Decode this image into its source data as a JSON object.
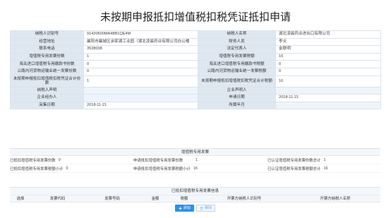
{
  "title": "未按期申报抵扣增值税扣税凭证抵扣申请",
  "info_rows": [
    {
      "l1": "纳税人识别号",
      "v1": "91420600MA48B1QE4M",
      "l2": "纳税人名称",
      "v2": "湖北凌晨药业进出口有限公司"
    },
    {
      "l1": "经营地址",
      "v1": "襄阳市襄城区余家湖工业园（湖北凌晨药业有限公司办公楼",
      "l2": "财务人员",
      "v2": "李炎"
    },
    {
      "l1": "联系电话",
      "v1": "3538038",
      "l2": "法定代表人",
      "v2": "金联明"
    },
    {
      "l1": "增值税专用发票份数",
      "v1": "1",
      "l2": "增值税专用发票税额",
      "v2": "16"
    },
    {
      "l1": "海关进口增值税专用缴款书份数",
      "v1": "0",
      "l2": "海关进口增值税专用缴款书税额",
      "v2": "0"
    },
    {
      "l1": "公路内河货物运输业统一发票份数",
      "v1": "0",
      "l2": "公路内河货物运输业统一发票税额",
      "v2": "0"
    },
    {
      "l1": "未按期申报抵扣增值税扣税凭证合计份数",
      "v1": "1",
      "l2": "未按期申报抵扣增值税扣税凭证合计税额",
      "v2": "16"
    },
    {
      "l1": "纳税人声明",
      "v1": "",
      "l2": "企业声明人",
      "v2": ""
    },
    {
      "l1": "企业经办人",
      "v1": "",
      "l2": "申请日期",
      "v2": "2018-11-21"
    },
    {
      "l1": "采集日期",
      "v1": "2018-11-21",
      "l2": "所属年月",
      "v2": ""
    }
  ],
  "stats": {
    "header": "增值税专用发票",
    "row1": [
      {
        "label": "已抵扣增值税专用发票份数",
        "value": "0"
      },
      {
        "label": "申请抵扣增值税专用发票份数",
        "value": "1"
      },
      {
        "label": "已认证增值税专用发票份数总计",
        "value": "1"
      }
    ],
    "row2": [
      {
        "label": "已抵扣增值税专用发票税额小计",
        "value": "0"
      },
      {
        "label": "申请抵扣增值税专用发票税额小计",
        "value": "16"
      },
      {
        "label": "已认证增值税专用发票税额总计",
        "value": "16"
      }
    ]
  },
  "detail": {
    "header": "已抵扣增值税专用发票信息",
    "columns": [
      "选择",
      "发票代码",
      "发票号码",
      "金额",
      "税额",
      "开票方纳税人识别号",
      "开票方纳税人名称"
    ],
    "add_label": "添加",
    "delete_label": "删除"
  },
  "colors": {
    "label_bg": "#dfe8f1",
    "accent": "#2f8fe6"
  }
}
